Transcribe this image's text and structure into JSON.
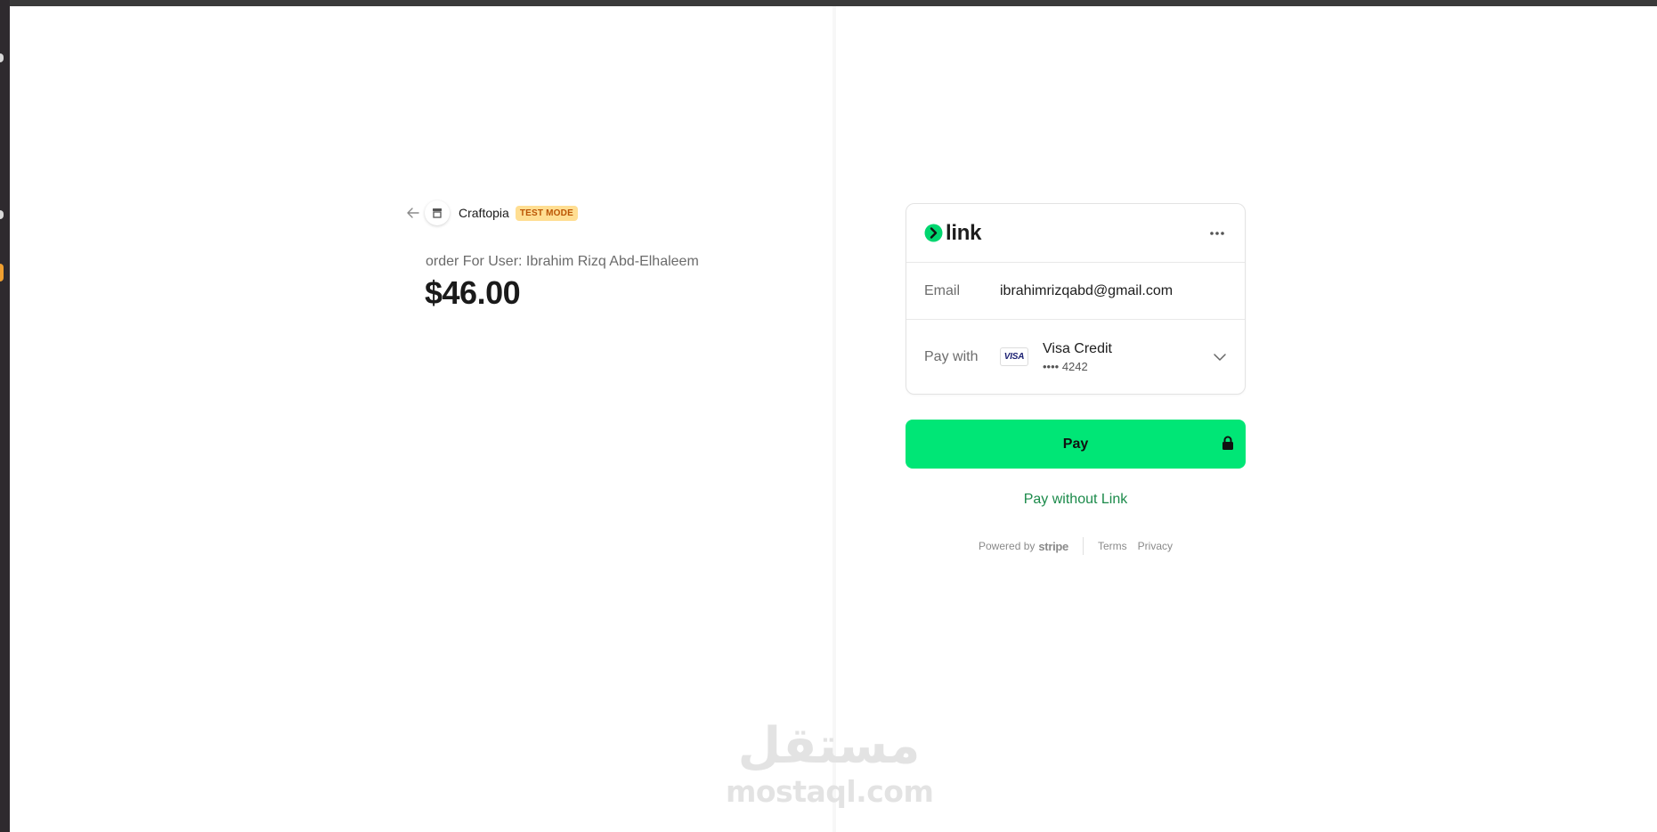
{
  "merchant": {
    "back_icon": "arrow-left-icon",
    "store_icon": "store-icon",
    "name": "Craftopia",
    "mode_badge": "TEST MODE"
  },
  "order": {
    "description": "order For User: Ibrahim Rizq Abd-Elhaleem",
    "amount": "$46.00"
  },
  "link_card": {
    "logo_text": "link",
    "more_icon": "more-horizontal-icon",
    "email_label": "Email",
    "email_value": "ibrahimrizqabd@gmail.com",
    "pay_with_label": "Pay with",
    "card_brand_badge": "VISA",
    "card_name": "Visa Credit",
    "card_last4": "•••• 4242",
    "chevron_icon": "chevron-down-icon"
  },
  "pay_button": {
    "label": "Pay",
    "icon": "lock-icon"
  },
  "pay_without_link": "Pay without Link",
  "footer": {
    "powered_by": "Powered by",
    "brand": "stripe",
    "terms": "Terms",
    "privacy": "Privacy"
  },
  "watermark": {
    "arabic": "مستقل",
    "latin": "mostaql.com"
  },
  "colors": {
    "pay_button": "#00e676",
    "link_green": "#1b8a4a",
    "badge_bg": "#ffde92",
    "badge_text": "#bb5504"
  }
}
